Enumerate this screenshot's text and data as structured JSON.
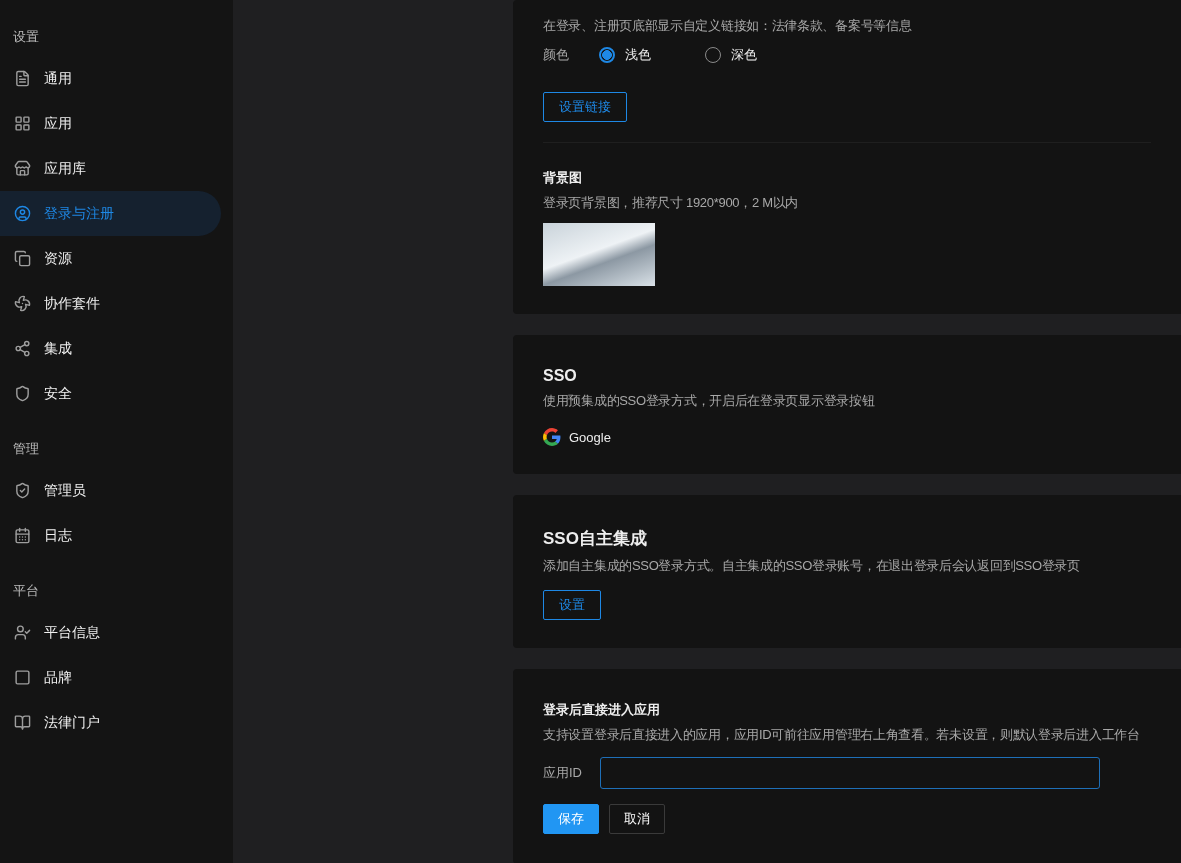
{
  "sidebar": {
    "sections": [
      {
        "title": "设置",
        "items": [
          {
            "label": "通用",
            "selected": false
          },
          {
            "label": "应用",
            "selected": false
          },
          {
            "label": "应用库",
            "selected": false
          },
          {
            "label": "登录与注册",
            "selected": true
          },
          {
            "label": "资源",
            "selected": false
          },
          {
            "label": "协作套件",
            "selected": false
          },
          {
            "label": "集成",
            "selected": false
          },
          {
            "label": "安全",
            "selected": false
          }
        ]
      },
      {
        "title": "管理",
        "items": [
          {
            "label": "管理员",
            "selected": false
          },
          {
            "label": "日志",
            "selected": false
          }
        ]
      },
      {
        "title": "平台",
        "items": [
          {
            "label": "平台信息",
            "selected": false
          },
          {
            "label": "品牌",
            "selected": false
          },
          {
            "label": "法律门户",
            "selected": false
          }
        ]
      }
    ]
  },
  "footer_card": {
    "description": "在登录、注册页底部显示自定义链接如：法律条款、备案号等信息",
    "color_label": "颜色",
    "color_options": [
      {
        "label": "浅色",
        "selected": true
      },
      {
        "label": "深色",
        "selected": false
      }
    ],
    "button": "设置链接",
    "background": {
      "title": "背景图",
      "description": "登录页背景图，推荐尺寸 1920*900，2 M以内"
    }
  },
  "sso_card": {
    "title": "SSO",
    "description": "使用预集成的SSO登录方式，开启后在登录页显示登录按钮",
    "providers": [
      {
        "label": "Google"
      }
    ]
  },
  "custom_sso_card": {
    "title": "SSO自主集成",
    "description": "添加自主集成的SSO登录方式。自主集成的SSO登录账号，在退出登录后会认返回到SSO登录页",
    "button": "设置"
  },
  "redirect_card": {
    "title": "登录后直接进入应用",
    "description": "支持设置登录后直接进入的应用，应用ID可前往应用管理右上角查看。若未设置，则默认登录后进入工作台",
    "field_label": "应用ID",
    "buttons": [
      {
        "label": "保存",
        "kind": "primary"
      },
      {
        "label": "取消",
        "kind": "secondary"
      }
    ]
  }
}
